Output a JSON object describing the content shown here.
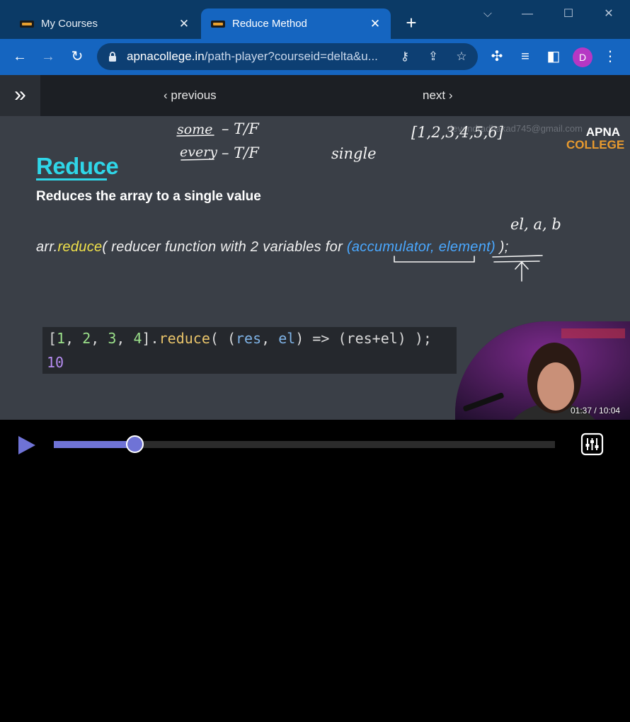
{
  "tabs": [
    {
      "title": "My Courses",
      "active": false,
      "icon": "apna-college-favicon"
    },
    {
      "title": "Reduce Method",
      "active": true,
      "icon": "apna-college-favicon"
    }
  ],
  "toolbar": {
    "url_host": "apnacollege.in",
    "url_path": "/path-player?courseid=delta&u...",
    "avatar_letter": "D"
  },
  "player_nav": {
    "previous_label": "previous",
    "next_label": "next"
  },
  "slide": {
    "title": "Reduce",
    "subtitle": "Reduces the array to a single value",
    "syntax": {
      "prefix": "arr.",
      "method": "reduce",
      "middle": "( reducer function with 2 variables for ",
      "params": "(accumulator, element)",
      "suffix": " );"
    },
    "code": {
      "open": "[",
      "nums": [
        "1",
        "2",
        "3",
        "4"
      ],
      "close": "].",
      "fn": "reduce",
      "paren_open": "( (",
      "arg1": "res",
      "comma": ", ",
      "arg2": "el",
      "rest": ") => (res+el) );",
      "output": "10"
    },
    "watermark": "devendradhakad745@gmail.com",
    "logo_line1": "APNA",
    "logo_line2": "COLLEGE",
    "annotations": {
      "some": "some",
      "every": "every",
      "tf": "– T/F",
      "single": "single",
      "array": "[1,2,3,4,5,6]",
      "el_ab": "el, a, b"
    }
  },
  "video": {
    "current_time": "01:37",
    "duration": "10:04",
    "time_display": "01:37 / 10:04",
    "progress": 0.161
  },
  "colors": {
    "accent": "#6f73d6",
    "chrome_blue": "#1565c0",
    "title_cyan": "#2fd6e8"
  }
}
